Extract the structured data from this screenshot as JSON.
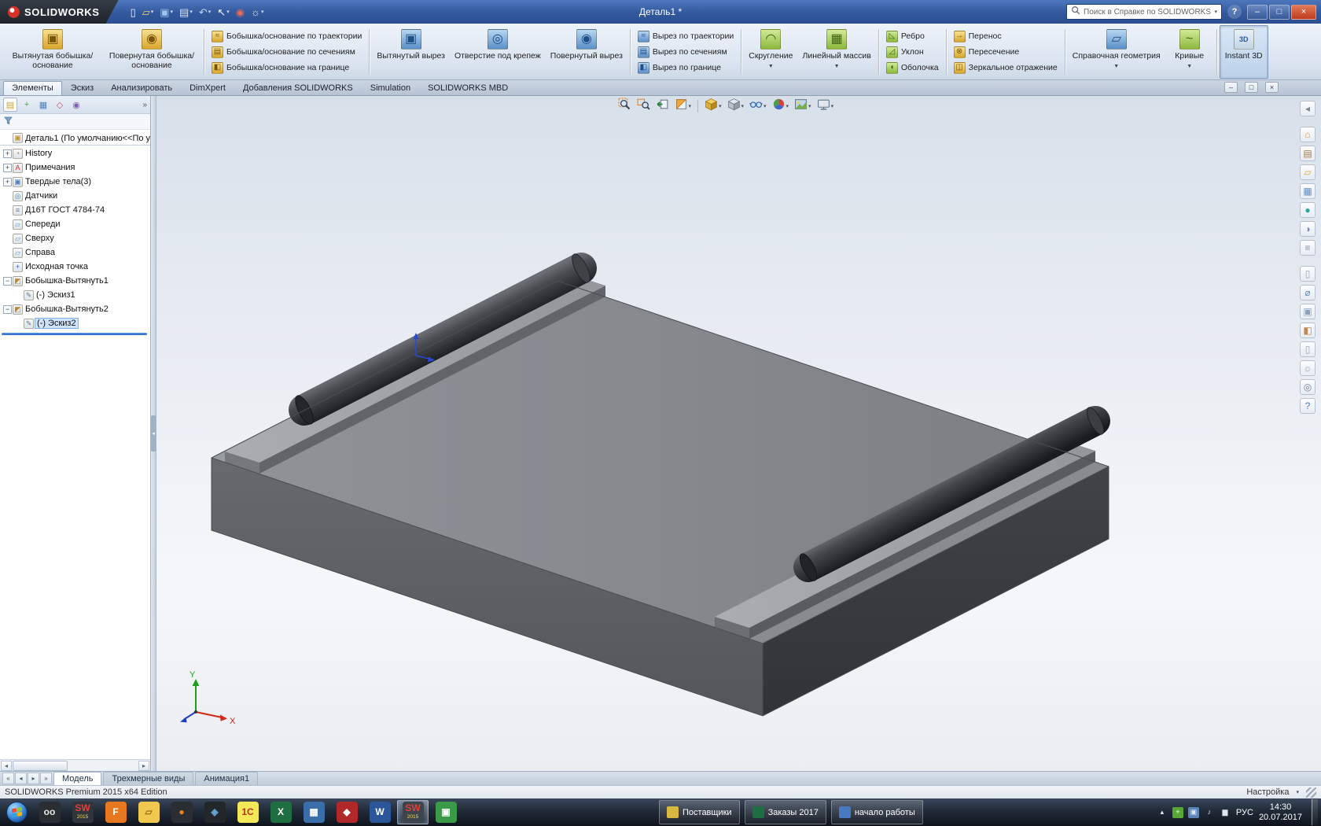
{
  "titlebar": {
    "brand": "SOLIDWORKS",
    "title": "Деталь1 *",
    "search_placeholder": "Поиск в Справке по SOLIDWORKS",
    "help_glyph": "?",
    "quick_tools": [
      {
        "name": "new-document-icon",
        "glyph": "▯",
        "color": "#f2f6fa"
      },
      {
        "name": "open-folder-icon",
        "glyph": "▱",
        "color": "#f5d36a",
        "dd": true
      },
      {
        "name": "save-icon",
        "glyph": "▣",
        "color": "#9cc6ee",
        "dd": true
      },
      {
        "name": "print-icon",
        "glyph": "▤",
        "color": "#d9e2ec",
        "dd": true
      },
      {
        "name": "undo-icon",
        "glyph": "↶",
        "color": "#bcd8f0",
        "dd": true
      },
      {
        "name": "select-cursor-icon",
        "glyph": "↖",
        "color": "#f5f8fb",
        "dd": true
      },
      {
        "name": "rebuild-icon",
        "glyph": "◉",
        "color": "#ef6a52"
      },
      {
        "name": "options-icon",
        "glyph": "☼",
        "color": "#dfe7f0",
        "dd": true
      }
    ],
    "window_buttons": [
      {
        "name": "minimize-button",
        "glyph": "–"
      },
      {
        "name": "maximize-button",
        "glyph": "□"
      },
      {
        "name": "close-button",
        "glyph": "×"
      }
    ]
  },
  "ribbon": {
    "groups": [
      {
        "type": "large",
        "items": [
          {
            "label": "Вытянутая бобышка/основание",
            "icon": "extruded-boss-icon"
          },
          {
            "label": "Повернутая бобышка/основание",
            "icon": "revolved-boss-icon"
          }
        ]
      },
      {
        "type": "stack",
        "items": [
          {
            "label": "Бобышка/основание по траектории",
            "icon": "swept-boss-icon"
          },
          {
            "label": "Бобышка/основание по сечениям",
            "icon": "lofted-boss-icon"
          },
          {
            "label": "Бобышка/основание на границе",
            "icon": "boundary-boss-icon"
          }
        ]
      },
      {
        "type": "large",
        "items": [
          {
            "label": "Вытянутый вырез",
            "icon": "extruded-cut-icon"
          },
          {
            "label": "Отверстие под крепеж",
            "icon": "hole-wizard-icon"
          },
          {
            "label": "Повернутый вырез",
            "icon": "revolved-cut-icon"
          }
        ]
      },
      {
        "type": "stack",
        "items": [
          {
            "label": "Вырез по траектории",
            "icon": "swept-cut-icon"
          },
          {
            "label": "Вырез по сечениям",
            "icon": "lofted-cut-icon"
          },
          {
            "label": "Вырез по границе",
            "icon": "boundary-cut-icon"
          }
        ]
      },
      {
        "type": "large",
        "items": [
          {
            "label": "Скругление",
            "icon": "fillet-icon",
            "dd": true
          },
          {
            "label": "Линейный массив",
            "icon": "linear-pattern-icon",
            "dd": true
          }
        ]
      },
      {
        "type": "stack",
        "items": [
          {
            "label": "Ребро",
            "icon": "rib-icon"
          },
          {
            "label": "Уклон",
            "icon": "draft-icon"
          },
          {
            "label": "Оболочка",
            "icon": "shell-icon"
          }
        ]
      },
      {
        "type": "stack",
        "items": [
          {
            "label": "Перенос",
            "icon": "move-icon"
          },
          {
            "label": "Пересечение",
            "icon": "intersect-icon"
          },
          {
            "label": "Зеркальное отражение",
            "icon": "mirror-icon"
          }
        ]
      },
      {
        "type": "large",
        "items": [
          {
            "label": "Справочная геометрия",
            "icon": "reference-geometry-icon",
            "dd": true
          },
          {
            "label": "Кривые",
            "icon": "curves-icon",
            "dd": true
          }
        ]
      },
      {
        "type": "large",
        "items": [
          {
            "label": "Instant 3D",
            "icon": "instant-3d-icon",
            "active": true
          }
        ]
      }
    ]
  },
  "command_tabs": {
    "items": [
      "Элементы",
      "Эскиз",
      "Анализировать",
      "DimXpert",
      "Добавления SOLIDWORKS",
      "Simulation",
      "SOLIDWORKS MBD"
    ],
    "active": "Элементы",
    "window_controls": [
      {
        "name": "doc-minimize-button",
        "glyph": "–"
      },
      {
        "name": "doc-restore-button",
        "glyph": "□"
      },
      {
        "name": "doc-close-button",
        "glyph": "×"
      }
    ]
  },
  "feature_panel": {
    "manager_tabs": [
      {
        "name": "feature-tree-tab-icon",
        "glyph": "▤",
        "color": "#caa02c"
      },
      {
        "name": "property-manager-tab-icon",
        "glyph": "+",
        "color": "#58a838"
      },
      {
        "name": "configuration-manager-tab-icon",
        "glyph": "▦",
        "color": "#5080c0"
      },
      {
        "name": "dimxpert-manager-tab-icon",
        "glyph": "◇",
        "color": "#c05858"
      },
      {
        "name": "display-manager-tab-icon",
        "glyph": "◉",
        "color": "#8060b0"
      }
    ],
    "overflow": "»",
    "items": [
      {
        "label": "Деталь1 (По умолчанию<<По у",
        "icon": "part-icon",
        "indent": 0,
        "expander": null,
        "root": true
      },
      {
        "label": "History",
        "icon": "history-icon",
        "indent": 0,
        "expander": "plus"
      },
      {
        "label": "Примечания",
        "icon": "annotations-icon",
        "indent": 0,
        "expander": "plus"
      },
      {
        "label": "Твердые тела(3)",
        "icon": "solid-bodies-icon",
        "indent": 0,
        "expander": "plus"
      },
      {
        "label": "Датчики",
        "icon": "sensors-icon",
        "indent": 0,
        "expander": null
      },
      {
        "label": "Д16Т ГОСТ 4784-74",
        "icon": "material-icon",
        "indent": 0,
        "expander": null
      },
      {
        "label": "Спереди",
        "icon": "plane-icon",
        "indent": 0,
        "expander": null
      },
      {
        "label": "Сверху",
        "icon": "plane-icon",
        "indent": 0,
        "expander": null
      },
      {
        "label": "Справа",
        "icon": "plane-icon",
        "indent": 0,
        "expander": null
      },
      {
        "label": "Исходная точка",
        "icon": "origin-icon",
        "indent": 0,
        "expander": null
      },
      {
        "label": "Бобышка-Вытянуть1",
        "icon": "boss-extrude-icon",
        "indent": 0,
        "expander": "minus"
      },
      {
        "label": "(-) Эскиз1",
        "icon": "sketch-icon",
        "indent": 1,
        "expander": null
      },
      {
        "label": "Бобышка-Вытянуть2",
        "icon": "boss-extrude-icon",
        "indent": 0,
        "expander": "minus"
      },
      {
        "label": "(-) Эскиз2",
        "icon": "sketch-icon",
        "indent": 1,
        "expander": null,
        "selected": true
      }
    ]
  },
  "viewport": {
    "headsup": [
      {
        "name": "zoom-fit"
      },
      {
        "name": "zoom-area"
      },
      {
        "name": "previous-view"
      },
      {
        "name": "section-view",
        "dd": true
      },
      {
        "name": "separator"
      },
      {
        "name": "view-orientation",
        "dd": true
      },
      {
        "name": "display-style",
        "dd": true
      },
      {
        "name": "hide-show-items",
        "dd": true
      },
      {
        "name": "edit-appearance",
        "dd": true
      },
      {
        "name": "apply-scene",
        "dd": true
      },
      {
        "name": "view-settings",
        "dd": true
      }
    ],
    "triad": {
      "x_label": "X",
      "y_label": "Y"
    },
    "colors": {
      "plate_top": "#85898d",
      "plate_front": "#5d6165",
      "plate_side": "#3b3f43",
      "rail": "#9ea2a6",
      "rod": "#2a2d30",
      "background_top": "#d8e0ea",
      "background_bottom": "#ebedf0"
    }
  },
  "right_toolbar": {
    "icons": [
      {
        "name": "collapse-arrow-icon",
        "glyph": "◂",
        "color": "#7a8894"
      },
      {
        "name": "home-icon",
        "glyph": "⌂",
        "color": "#d89830"
      },
      {
        "name": "design-library-icon",
        "glyph": "▤",
        "color": "#a87840"
      },
      {
        "name": "file-explorer-icon",
        "glyph": "▱",
        "color": "#d8a830"
      },
      {
        "name": "view-palette-icon",
        "glyph": "▦",
        "color": "#6090c0"
      },
      {
        "name": "appearances-icon",
        "glyph": "●",
        "color": "#28a8a0"
      },
      {
        "name": "scenes-icon",
        "glyph": "◑",
        "color": "#7888c0"
      },
      {
        "name": "custom-properties-icon",
        "glyph": "≡",
        "color": "#8894a2"
      },
      {
        "name": "document-icon",
        "glyph": "▯",
        "color": "#98a6b4"
      },
      {
        "name": "measure-icon",
        "glyph": "⌀",
        "color": "#5888b8"
      },
      {
        "name": "mass-properties-icon",
        "glyph": "▣",
        "color": "#88a0b8"
      },
      {
        "name": "section-icon",
        "glyph": "◧",
        "color": "#c08850"
      },
      {
        "name": "document-icon",
        "glyph": "▯",
        "color": "#98a6b4"
      },
      {
        "name": "settings-icon",
        "glyph": "☼",
        "color": "#8894a2"
      },
      {
        "name": "camera-icon",
        "glyph": "◎",
        "color": "#708090"
      },
      {
        "name": "help-icon",
        "glyph": "?",
        "color": "#4878c0"
      }
    ]
  },
  "model_tabs": {
    "nav": [
      "«",
      "◂",
      "▸",
      "»"
    ],
    "items": [
      "Модель",
      "Трехмерные виды",
      "Анимация1"
    ],
    "active": "Модель"
  },
  "statusbar": {
    "left": "SOLIDWORKS Premium 2015 x64 Edition",
    "right": "Настройка"
  },
  "taskbar": {
    "apps": [
      {
        "name": "two-circles-app-icon",
        "glyph": "oo",
        "bg": "#2a2e33",
        "fg": "#e8eaec"
      },
      {
        "name": "solidworks-launcher-icon",
        "glyph": "SW",
        "sub": "2015",
        "bg": "#30353b",
        "fg": "#e04038"
      },
      {
        "name": "f-app-icon",
        "glyph": "F",
        "bg": "#e87820",
        "fg": "#ffffff"
      },
      {
        "name": "folder-explorer-icon",
        "glyph": "▱",
        "bg": "#f0c850",
        "fg": "#9a7418"
      },
      {
        "name": "firefox-icon",
        "glyph": "●",
        "bg": "#2a2e33",
        "fg": "#f08020"
      },
      {
        "name": "dark-app-icon",
        "glyph": "◈",
        "bg": "#23262b",
        "fg": "#68a8d8"
      },
      {
        "name": "1c-icon",
        "glyph": "1С",
        "bg": "#f2e858",
        "fg": "#c03020"
      },
      {
        "name": "excel-icon",
        "glyph": "X",
        "bg": "#1e6e42",
        "fg": "#ffffff"
      },
      {
        "name": "blue-app-icon",
        "glyph": "▦",
        "bg": "#3a6ea8",
        "fg": "#ffffff"
      },
      {
        "name": "red-app-icon",
        "glyph": "◆",
        "bg": "#b02828",
        "fg": "#ffffff"
      },
      {
        "name": "word-icon",
        "glyph": "W",
        "bg": "#2b579a",
        "fg": "#ffffff"
      },
      {
        "name": "solidworks-2015-icon",
        "glyph": "SW",
        "sub": "2015",
        "bg": "#3d444c",
        "fg": "#e04038",
        "active": true
      },
      {
        "name": "green-app-icon",
        "glyph": "▣",
        "bg": "#3a9a48",
        "fg": "#ffffff"
      }
    ],
    "window_buttons": [
      {
        "label": "Поставщики",
        "icon_bg": "#d8b840"
      },
      {
        "label": "Заказы 2017",
        "icon_bg": "#1e6e42"
      },
      {
        "label": "начало работы",
        "icon_bg": "#4878c0"
      }
    ],
    "tray": {
      "icons": [
        {
          "name": "tray-expand-icon",
          "glyph": "▴",
          "bg": "transparent",
          "fg": "#e6ecf2"
        },
        {
          "name": "antivirus-shield-icon",
          "glyph": "+",
          "bg": "#58a838",
          "fg": "#ffffff"
        },
        {
          "name": "display-icon",
          "glyph": "▣",
          "bg": "#5a85b8",
          "fg": "#dce8f4"
        },
        {
          "name": "volume-icon",
          "glyph": "♪",
          "bg": "transparent",
          "fg": "#dfe6ee"
        },
        {
          "name": "network-icon",
          "glyph": "▆",
          "bg": "transparent",
          "fg": "#dfe6ee"
        }
      ],
      "lang": "РУС",
      "time": "14:30",
      "date": "20.07.2017"
    }
  }
}
